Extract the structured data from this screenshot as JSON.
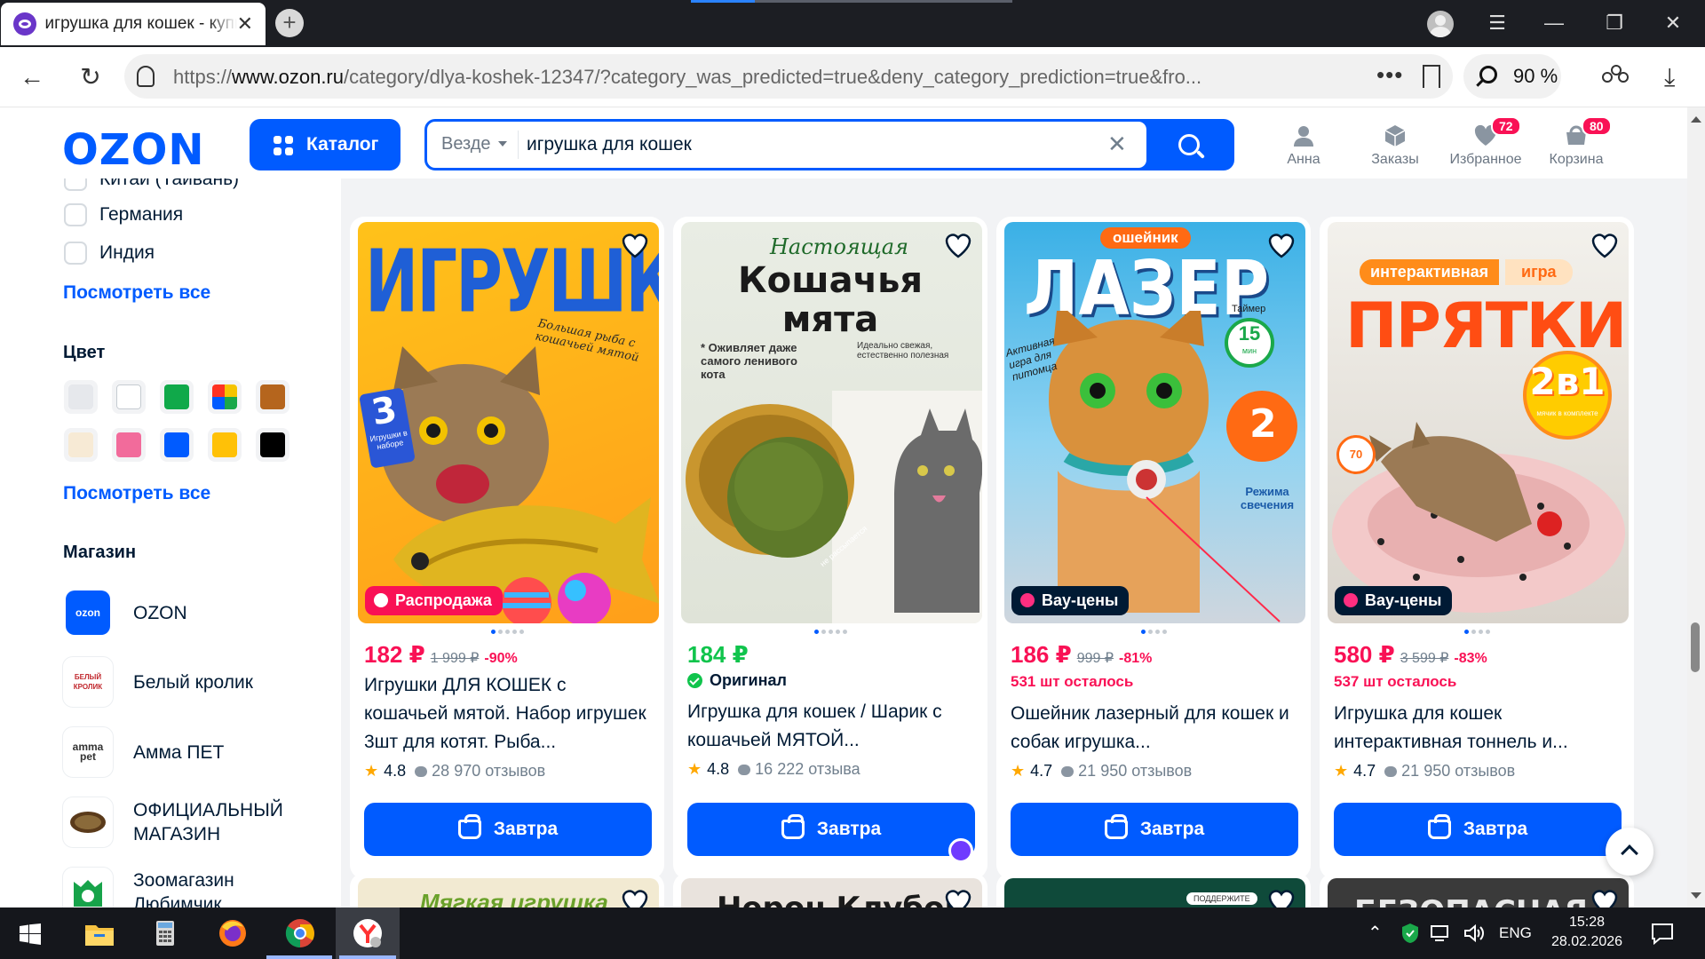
{
  "browser": {
    "tab_title": "игрушка для кошек - купить",
    "url_prefix": "https://",
    "url_domain": "www.ozon.ru",
    "url_path": "/category/dlya-koshek-12347/?category_was_predicted=true&deny_category_prediction=true&fro...",
    "zoom": "90 %"
  },
  "header": {
    "logo": "OZON",
    "catalog_label": "Каталог",
    "search_scope": "Везде",
    "search_query": "игрушка для кошек",
    "nav": [
      {
        "label": "Анна",
        "badge": ""
      },
      {
        "label": "Заказы",
        "badge": ""
      },
      {
        "label": "Избранное",
        "badge": "72"
      },
      {
        "label": "Корзина",
        "badge": "80"
      }
    ]
  },
  "sidebar": {
    "countries": [
      "Китай (Тайвань)",
      "Германия",
      "Индия"
    ],
    "see_all": "Посмотреть все",
    "color_title": "Цвет",
    "colors": [
      "#e6e8ec",
      "#ffffff",
      "#10a94a",
      "multicolor",
      "#b5651d",
      "#f7ead5",
      "#f26b9b",
      "#005bff",
      "#ffc107",
      "#000000"
    ],
    "shop_title": "Магазин",
    "shops": [
      {
        "name": "OZON",
        "logo": "ozon"
      },
      {
        "name": "Белый кролик",
        "logo": "БЕЛЫЙ КРОЛИК"
      },
      {
        "name": "Амма ПЕТ",
        "logo": "amma pet"
      },
      {
        "name": "ОФИЦИАЛЬНЫЙ МАГАЗИН",
        "logo": "shield"
      },
      {
        "name": "Зоомагазин Любимчик",
        "logo": "Любимчик"
      }
    ]
  },
  "products": [
    {
      "image_text": [
        "ИГРУШКИ",
        "Большая рыба с кошачьей мятой",
        "3",
        "Игрушки в наборе"
      ],
      "badge": "Распродажа",
      "price": "182 ₽",
      "old_price": "1 999 ₽",
      "discount": "-90%",
      "extra": "",
      "title": "Игрушки ДЛЯ КОШЕК с кошачьей мятой. Набор игрушек 3шт для котят. Рыба...",
      "rating": "4.8",
      "reviews": "28 970 отзывов",
      "button": "Завтра"
    },
    {
      "image_text": [
        "Настоящая",
        "Кошачья мята",
        "* Оживляет даже самого ленивого кота",
        "Идеально свежая, естественно полезная",
        "не рассыпается"
      ],
      "badge": "",
      "price": "184 ₽",
      "old_price": "",
      "discount": "",
      "extra": "Оригинал",
      "title": "Игрушка для кошек / Шарик с кошачьей МЯТОЙ...",
      "rating": "4.8",
      "reviews": "16 222 отзыва",
      "button": "Завтра"
    },
    {
      "image_text": [
        "ошейник",
        "ЛАЗЕР",
        "Активная игра для питомца",
        "Таймер",
        "15",
        "мин",
        "2",
        "Режима свечения"
      ],
      "badge": "Вау-цены",
      "price": "186 ₽",
      "old_price": "999 ₽",
      "discount": "-81%",
      "extra": "531 шт осталось",
      "title": "Ошейник лазерный для кошек и собак игрушка...",
      "rating": "4.7",
      "reviews": "21 950 отзывов",
      "button": "Завтра"
    },
    {
      "image_text": [
        "интерактивная",
        "игра",
        "ПРЯТКИ",
        "2в1",
        "мячик в комплекте",
        "70"
      ],
      "badge": "Вау-цены",
      "price": "580 ₽",
      "old_price": "3 599 ₽",
      "discount": "-83%",
      "extra": "537 шт осталось",
      "title": "Игрушка для кошек интерактивная тоннель и...",
      "rating": "4.7",
      "reviews": "21 950 отзывов",
      "button": "Завтра"
    }
  ],
  "next_row": [
    "Мягкая игрушка",
    "Нерон Клубок",
    "ПОДДЕРЖИТЕ",
    "БЕЗОПАСНАЯ"
  ],
  "taskbar": {
    "lang": "ENG",
    "time": "15:28",
    "date": "28.02.2026"
  }
}
